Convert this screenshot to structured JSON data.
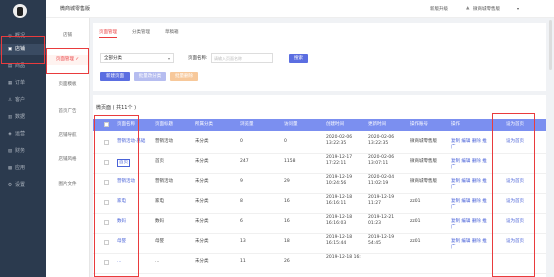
{
  "sidebar": {
    "items": [
      {
        "label": "概况",
        "icon": "overview-icon"
      },
      {
        "label": "店铺",
        "icon": "shop-icon"
      },
      {
        "label": "商品",
        "icon": "goods-icon"
      },
      {
        "label": "订单",
        "icon": "order-icon"
      },
      {
        "label": "客户",
        "icon": "customer-icon"
      },
      {
        "label": "数据",
        "icon": "data-icon"
      },
      {
        "label": "运营",
        "icon": "operation-icon"
      },
      {
        "label": "财务",
        "icon": "finance-icon"
      },
      {
        "label": "应用",
        "icon": "app-icon"
      },
      {
        "label": "设置",
        "icon": "settings-icon"
      }
    ],
    "active_index": 1
  },
  "subnav": {
    "items": [
      "店铺",
      "页面管理 ✓",
      "页面模板",
      "首页广告",
      "店铺导航",
      "店铺风格",
      "图片文件"
    ]
  },
  "topbar": {
    "shop_name": "微商城零售版",
    "help": "新版升级",
    "user": "微商城零售版"
  },
  "tabs": [
    "页面管理",
    "分类管理",
    "草稿箱"
  ],
  "filter": {
    "category": "全部分类",
    "name_label": "页面名称:",
    "name_placeholder": "请输入页面名称",
    "search": "搜索"
  },
  "actions": {
    "new_page": "新建页面",
    "batch_cat": "批量改分类",
    "batch_del": "批量删除"
  },
  "table": {
    "title": "微页面 ( 共11个 )",
    "headers": [
      "页面名称",
      "页面标题",
      "所属分类",
      "浏览量",
      "访问量",
      "创建时间",
      "更新时间",
      "操作账号",
      "操作",
      "设为首页"
    ],
    "rows": [
      {
        "name": "营销活动·基础",
        "title": "营销活动",
        "cat": "未分类",
        "pv": "0",
        "uv": "0",
        "created": "2020-02-06 13:22:35",
        "updated": "2020-02-06 13:22:35",
        "operator": "微商城零售版",
        "ops": "复制 编辑 删除 推广",
        "home": "设为首页"
      },
      {
        "name": "首页",
        "badge": "首页",
        "title": "首页",
        "cat": "未分类",
        "pv": "247",
        "uv": "1158",
        "created": "2019-12-17 17:22:11",
        "updated": "2020-02-06 13:07:11",
        "operator": "微商城零售版",
        "ops": "复制 编辑 删除 推广",
        "home": ""
      },
      {
        "name": "营销活动",
        "title": "营销活动",
        "cat": "未分类",
        "pv": "9",
        "uv": "29",
        "created": "2019-12-19 10:24:56",
        "updated": "2020-02-04 11:02:19",
        "operator": "微商城零售版",
        "ops": "复制 编辑 删除 推广",
        "home": "设为首页"
      },
      {
        "name": "家电",
        "title": "家电",
        "cat": "未分类",
        "pv": "8",
        "uv": "16",
        "created": "2019-12-18 16:16:11",
        "updated": "2019-12-19 11:27",
        "operator": "zz01",
        "ops": "复制 编辑 删除 推广",
        "home": "设为首页"
      },
      {
        "name": "数码",
        "title": "数码",
        "cat": "未分类",
        "pv": "6",
        "uv": "16",
        "created": "2019-12-18 16:16:03",
        "updated": "2019-12-21 01:23",
        "operator": "zz01",
        "ops": "复制 编辑 删除 推广",
        "home": "设为首页"
      },
      {
        "name": "母婴",
        "title": "母婴",
        "cat": "未分类",
        "pv": "13",
        "uv": "18",
        "created": "2019-12-18 16:15:44",
        "updated": "2019-12-19 54:45",
        "operator": "zz01",
        "ops": "复制 编辑 删除 推广",
        "home": "设为首页"
      },
      {
        "name": "…",
        "title": "…",
        "cat": "未分类",
        "pv": "11",
        "uv": "26",
        "created": "2019-12-18 16:",
        "updated": "",
        "operator": "",
        "ops": "",
        "home": ""
      }
    ]
  },
  "colors": {
    "accent": "#e93b3d",
    "header": "#7b8ff0",
    "sidebar": "#2b3a4e",
    "button": "#5b6ee1"
  }
}
